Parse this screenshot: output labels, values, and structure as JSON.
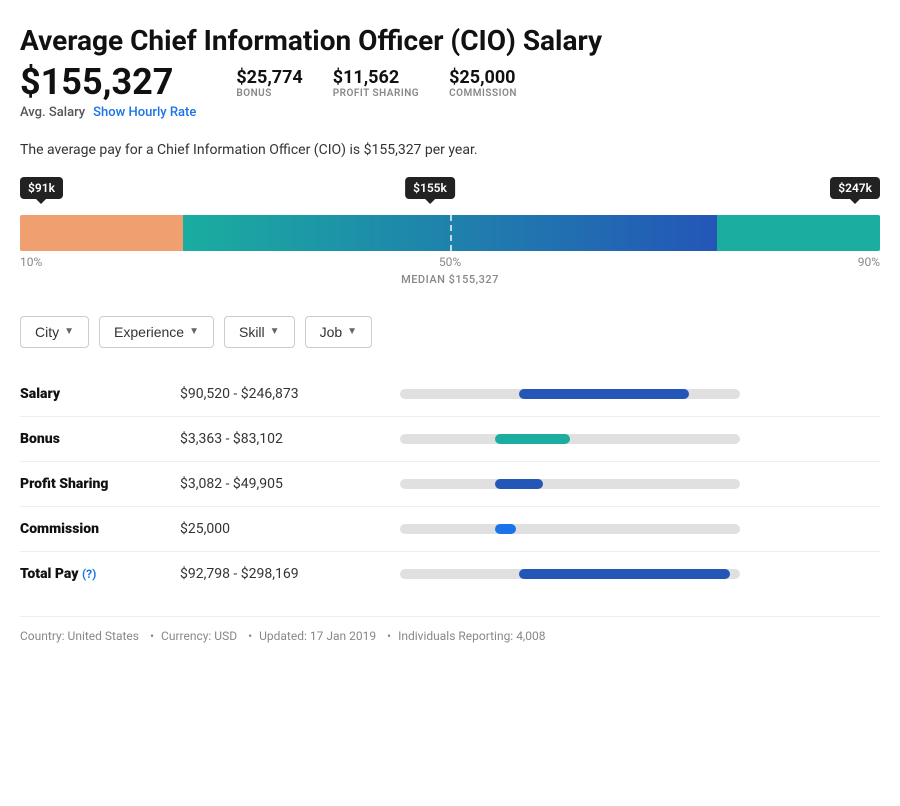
{
  "page": {
    "title": "Average Chief Information Officer (CIO) Salary",
    "main_salary": "$155,327",
    "avg_label": "Avg. Salary",
    "show_hourly_link": "Show Hourly Rate",
    "bonus_value": "$25,774",
    "bonus_label": "BONUS",
    "profit_sharing_value": "$11,562",
    "profit_sharing_label": "PROFIT SHARING",
    "commission_value": "$25,000",
    "commission_label": "COMMISSION",
    "description": "The average pay for a Chief Information Officer (CIO) is $155,327 per year.",
    "bar": {
      "low_tooltip": "$91k",
      "mid_tooltip": "$155k",
      "high_tooltip": "$247k",
      "low_percentile": "10%",
      "mid_percentile": "50%",
      "high_percentile": "90%",
      "median_label": "MEDIAN $155,327"
    },
    "filters": [
      {
        "label": "City",
        "id": "city-filter"
      },
      {
        "label": "Experience",
        "id": "experience-filter"
      },
      {
        "label": "Skill",
        "id": "skill-filter"
      },
      {
        "label": "Job",
        "id": "job-filter"
      }
    ],
    "compensation": [
      {
        "label": "Salary",
        "range": "$90,520 - $246,873",
        "bar_start_pct": 35,
        "bar_width_pct": 50,
        "bar_color": "#2456b8"
      },
      {
        "label": "Bonus",
        "range": "$3,363 - $83,102",
        "bar_start_pct": 28,
        "bar_width_pct": 22,
        "bar_color": "#1aada0"
      },
      {
        "label": "Profit Sharing",
        "range": "$3,082 - $49,905",
        "bar_start_pct": 28,
        "bar_width_pct": 14,
        "bar_color": "#2456b8"
      },
      {
        "label": "Commission",
        "range": "$25,000",
        "bar_start_pct": 28,
        "bar_width_pct": 6,
        "bar_color": "#1a73e8"
      },
      {
        "label": "Total Pay",
        "range": "$92,798 - $298,169",
        "bar_start_pct": 35,
        "bar_width_pct": 62,
        "bar_color": "#2456b8",
        "has_question": true,
        "question_label": "(?)"
      }
    ],
    "footer": {
      "country": "Country: United States",
      "currency": "Currency: USD",
      "updated": "Updated: 17 Jan 2019",
      "individuals": "Individuals Reporting: 4,008"
    }
  }
}
